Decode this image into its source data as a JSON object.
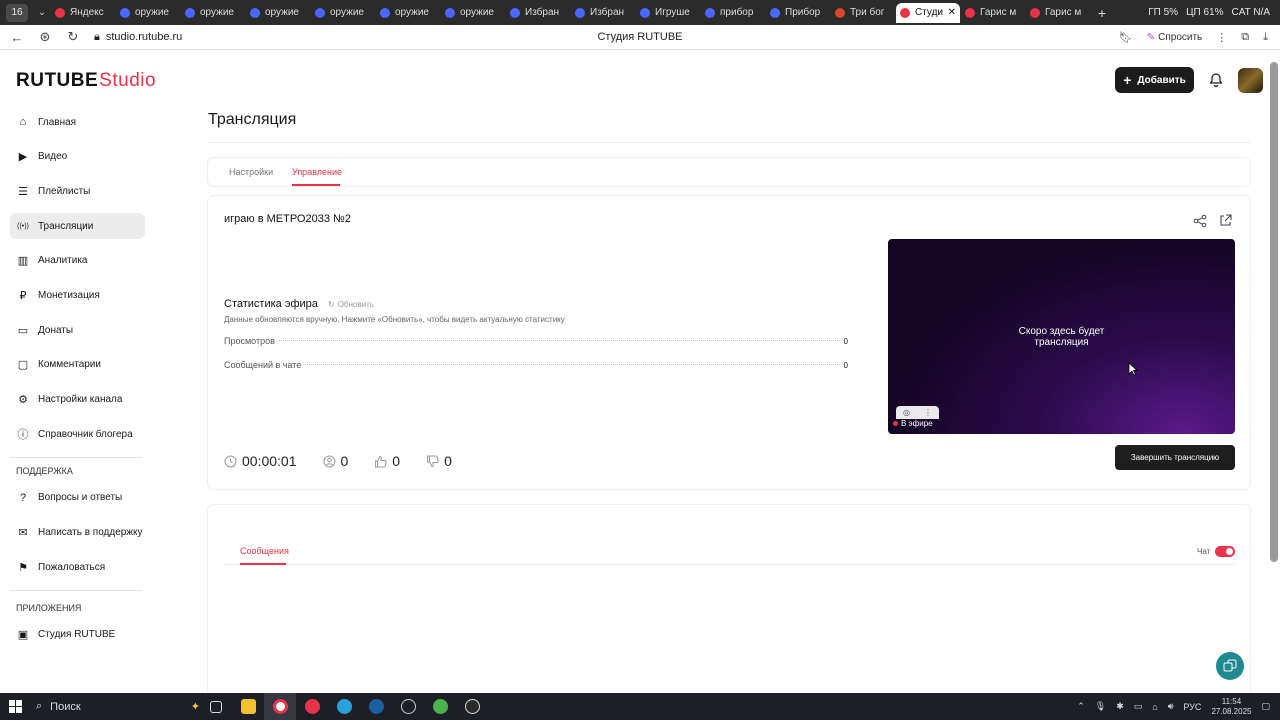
{
  "browser": {
    "tab_count": "16",
    "tabs": [
      {
        "label": "Яндекс",
        "color": "#e8334a"
      },
      {
        "label": "оружие",
        "color": "#4b67ff"
      },
      {
        "label": "оружие",
        "color": "#4b67ff"
      },
      {
        "label": "оружие",
        "color": "#4b67ff"
      },
      {
        "label": "оружие",
        "color": "#4b67ff"
      },
      {
        "label": "оружие",
        "color": "#4b67ff"
      },
      {
        "label": "оружие",
        "color": "#4b67ff"
      },
      {
        "label": "Избран",
        "color": "#4b67ff"
      },
      {
        "label": "Избран",
        "color": "#4b67ff"
      },
      {
        "label": "Игруше",
        "color": "#4b67ff"
      },
      {
        "label": "прибор",
        "color": "#4b67ff"
      },
      {
        "label": "Прибор",
        "color": "#4b67ff"
      },
      {
        "label": "Три бог",
        "color": "#d9452b"
      },
      {
        "label": "Студи",
        "color": "#e8334a",
        "active": true
      },
      {
        "label": "Гарис м",
        "color": "#e8334a"
      },
      {
        "label": "Гарис м",
        "color": "#e8334a"
      }
    ],
    "status_right": [
      "ГП 5%",
      "ЦП 61%",
      "CAT N/A"
    ],
    "url": "studio.rutube.ru",
    "page_title": "Студия RUTUBE",
    "ask_label": "Спросить"
  },
  "app": {
    "logo_main": "RUTUBE",
    "logo_studio": "Studio",
    "add_button": "Добавить",
    "page_heading": "Трансляция",
    "sidebar": {
      "items": [
        {
          "label": "Главная",
          "icon": "home-icon"
        },
        {
          "label": "Видео",
          "icon": "video-icon"
        },
        {
          "label": "Плейлисты",
          "icon": "playlist-icon"
        },
        {
          "label": "Трансляции",
          "icon": "broadcast-icon",
          "active": true
        },
        {
          "label": "Аналитика",
          "icon": "analytics-icon"
        },
        {
          "label": "Монетизация",
          "icon": "money-icon"
        },
        {
          "label": "Донаты",
          "icon": "donate-icon"
        },
        {
          "label": "Комментарии",
          "icon": "comments-icon"
        },
        {
          "label": "Настройки канала",
          "icon": "gear-icon"
        },
        {
          "label": "Справочник блогера",
          "icon": "info-icon"
        }
      ],
      "support_heading": "ПОДДЕРЖКА",
      "support_items": [
        {
          "label": "Вопросы и ответы",
          "icon": "help-icon"
        },
        {
          "label": "Написать в поддержку",
          "icon": "mail-icon"
        },
        {
          "label": "Пожаловаться",
          "icon": "flag-icon"
        }
      ],
      "apps_heading": "ПРИЛОЖЕНИЯ",
      "apps_items": [
        {
          "label": "Студия RUTUBE",
          "icon": "studio-app-icon"
        }
      ]
    },
    "tabs": {
      "settings": "Настройки",
      "control": "Управление"
    },
    "stream": {
      "title": "играю в МЕТРО2033 №2",
      "stats_title": "Статистика эфира",
      "refresh_label": "Обновить",
      "stats_hint": "Данные обновляются вручную. Нажмите «Обновить», чтобы видеть актуальную статистику",
      "stats": [
        {
          "label": "Просмотров",
          "value": "0"
        },
        {
          "label": "Сообщений в чате",
          "value": "0"
        }
      ],
      "duration": "00:00:01",
      "viewers": "0",
      "likes": "0",
      "dislikes": "0",
      "player_text_line1": "Скоро здесь будет",
      "player_text_line2": "трансляция",
      "live_label": "В эфире",
      "end_button": "Завершить трансляцию"
    },
    "chat": {
      "tab_label": "Сообщения",
      "toggle_label": "Чат",
      "toggle_on": true
    },
    "colors": {
      "accent": "#e8334a",
      "dark_button": "#1c1c1c",
      "help_fab": "#1f8a8f"
    }
  },
  "taskbar": {
    "search_label": "Поиск",
    "lang": "РУС",
    "time": "11:54",
    "date": "27.08.2025"
  }
}
